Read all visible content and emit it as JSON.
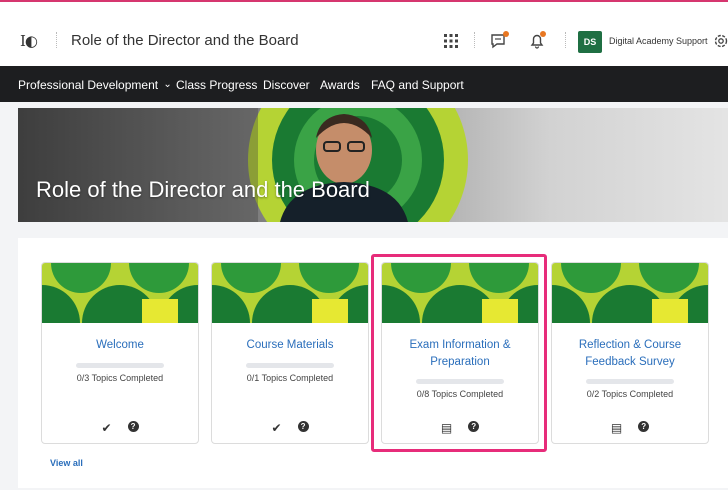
{
  "header": {
    "logo_text": "I◐",
    "course_title": "Role of the Director and the Board",
    "avatar_initials": "DS",
    "user_name": "Digital Academy Support",
    "icons": [
      "grid-icon",
      "chat-icon",
      "bell-icon",
      "gear-icon"
    ],
    "notification_color": "#e87722"
  },
  "nav": {
    "items": [
      "Professional Development",
      "Class Progress",
      "Discover",
      "Awards",
      "FAQ and Support"
    ],
    "dropdown_glyph": "⌄"
  },
  "banner": {
    "title": "Role of the Director and the Board"
  },
  "cards": [
    {
      "title": "Welcome",
      "progress_text": "0/3  Topics Completed",
      "completed": 0,
      "total": 3,
      "icons": [
        "check-icon",
        "help-icon"
      ]
    },
    {
      "title": "Course Materials",
      "progress_text": "0/1  Topics Completed",
      "completed": 0,
      "total": 1,
      "icons": [
        "check-icon",
        "help-icon"
      ]
    },
    {
      "title": "Exam Information & Preparation",
      "progress_text": "0/8  Topics Completed",
      "completed": 0,
      "total": 8,
      "icons": [
        "document-icon",
        "help-icon"
      ]
    },
    {
      "title": "Reflection & Course Feedback Survey",
      "progress_text": "0/2  Topics Completed",
      "completed": 0,
      "total": 2,
      "icons": [
        "document-icon",
        "help-icon"
      ]
    }
  ],
  "view_all": "View all",
  "colors": {
    "accent_pink": "#e72c7a",
    "link_blue": "#2a6ebb",
    "nav_bg": "#1d1e20",
    "brand_green": "#1f6f43",
    "card_green_light": "#b5d334",
    "card_green_dark": "#1a7a32"
  }
}
